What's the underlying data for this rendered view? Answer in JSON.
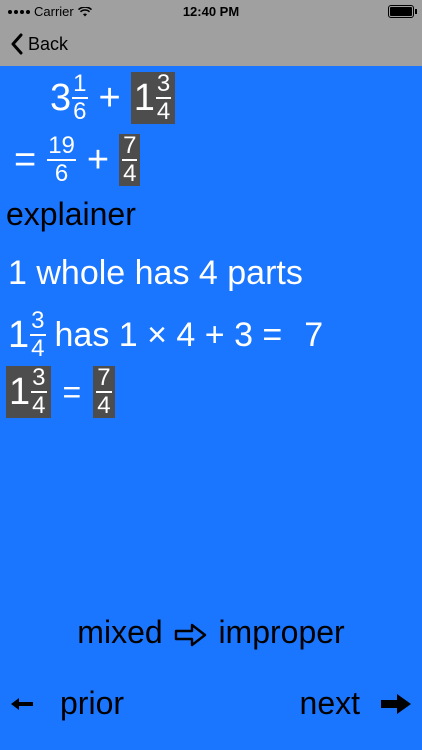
{
  "status": {
    "carrier": "Carrier",
    "time": "12:40 PM"
  },
  "nav": {
    "back_label": "Back"
  },
  "problem": {
    "line1": {
      "a_whole": "3",
      "a_num": "1",
      "a_den": "6",
      "op": "+",
      "b_whole": "1",
      "b_num": "3",
      "b_den": "4"
    },
    "line2": {
      "eq": "=",
      "c_num": "19",
      "c_den": "6",
      "op": "+",
      "d_num": "7",
      "d_den": "4"
    }
  },
  "explainer": {
    "title": "explainer",
    "line1": "1 whole has 4 parts",
    "line2": {
      "whole": "1",
      "num": "3",
      "den": "4",
      "text": "has 1 × 4 + 3 =",
      "result": "7"
    },
    "line3": {
      "whole": "1",
      "num": "3",
      "den": "4",
      "eq": "=",
      "r_num": "7",
      "r_den": "4"
    }
  },
  "footer": {
    "mode_from": "mixed",
    "mode_to": "improper",
    "prior_label": "prior",
    "next_label": "next"
  }
}
